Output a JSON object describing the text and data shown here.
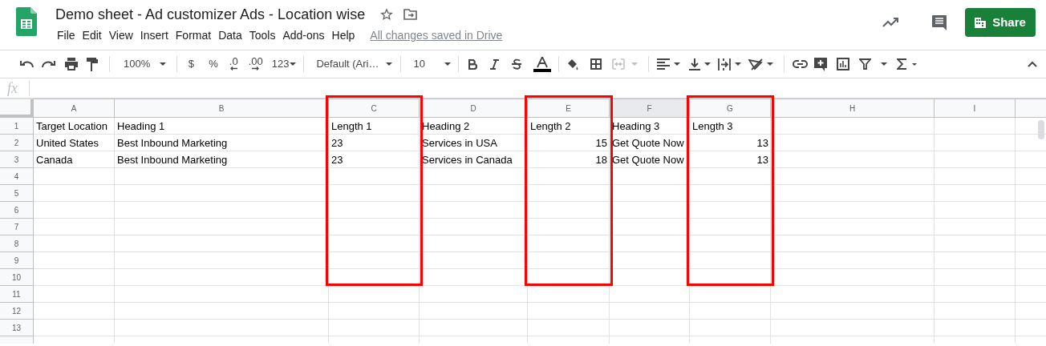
{
  "document": {
    "title": "Demo sheet - Ad customizer Ads - Location wise",
    "save_status": "All changes saved in Drive"
  },
  "menu": [
    "File",
    "Edit",
    "View",
    "Insert",
    "Format",
    "Data",
    "Tools",
    "Add-ons",
    "Help"
  ],
  "share_button": "Share",
  "toolbar": {
    "zoom": "100%",
    "currency": "$",
    "percent": "%",
    "decrease_decimals": ".0",
    "increase_decimals": ".00",
    "more_formats": "123",
    "font": "Default (Ari…",
    "font_size": "10",
    "merge_disabled": true
  },
  "formula_bar": {
    "label": "fx"
  },
  "columns": [
    {
      "letter": "A",
      "selected": false,
      "highlighted": false
    },
    {
      "letter": "B",
      "selected": false,
      "highlighted": false
    },
    {
      "letter": "C",
      "selected": false,
      "highlighted": true
    },
    {
      "letter": "D",
      "selected": false,
      "highlighted": false
    },
    {
      "letter": "E",
      "selected": false,
      "highlighted": true
    },
    {
      "letter": "F",
      "selected": true,
      "highlighted": false
    },
    {
      "letter": "G",
      "selected": false,
      "highlighted": true
    },
    {
      "letter": "H",
      "selected": false,
      "highlighted": false
    },
    {
      "letter": "I",
      "selected": false,
      "highlighted": false
    }
  ],
  "rows": [
    {
      "number": "1",
      "cells": [
        {
          "text": "Target Location",
          "kind": "text"
        },
        {
          "text": "Heading 1",
          "kind": "text"
        },
        {
          "text": "Length 1",
          "kind": "text"
        },
        {
          "text": "Heading 2",
          "kind": "text"
        },
        {
          "text": "Length 2",
          "kind": "text"
        },
        {
          "text": "Heading 3",
          "kind": "text"
        },
        {
          "text": "Length 3",
          "kind": "text"
        }
      ]
    },
    {
      "number": "2",
      "cells": [
        {
          "text": "United States",
          "kind": "text"
        },
        {
          "text": "Best Inbound Marketing",
          "kind": "text"
        },
        {
          "text": "23",
          "kind": "text"
        },
        {
          "text": "Services in USA",
          "kind": "text"
        },
        {
          "text": "15",
          "kind": "number"
        },
        {
          "text": "Get Quote Now",
          "kind": "text"
        },
        {
          "text": "13",
          "kind": "number"
        }
      ]
    },
    {
      "number": "3",
      "cells": [
        {
          "text": "Canada",
          "kind": "text"
        },
        {
          "text": "Best Inbound Marketing",
          "kind": "text"
        },
        {
          "text": "23",
          "kind": "text"
        },
        {
          "text": "Services in Canada",
          "kind": "text"
        },
        {
          "text": "18",
          "kind": "number"
        },
        {
          "text": "Get Quote Now",
          "kind": "text"
        },
        {
          "text": "13",
          "kind": "number"
        }
      ]
    },
    {
      "number": "4"
    },
    {
      "number": "5"
    },
    {
      "number": "6"
    },
    {
      "number": "7"
    },
    {
      "number": "8"
    },
    {
      "number": "9"
    },
    {
      "number": "10"
    },
    {
      "number": "11"
    },
    {
      "number": "12"
    },
    {
      "number": "13"
    }
  ]
}
